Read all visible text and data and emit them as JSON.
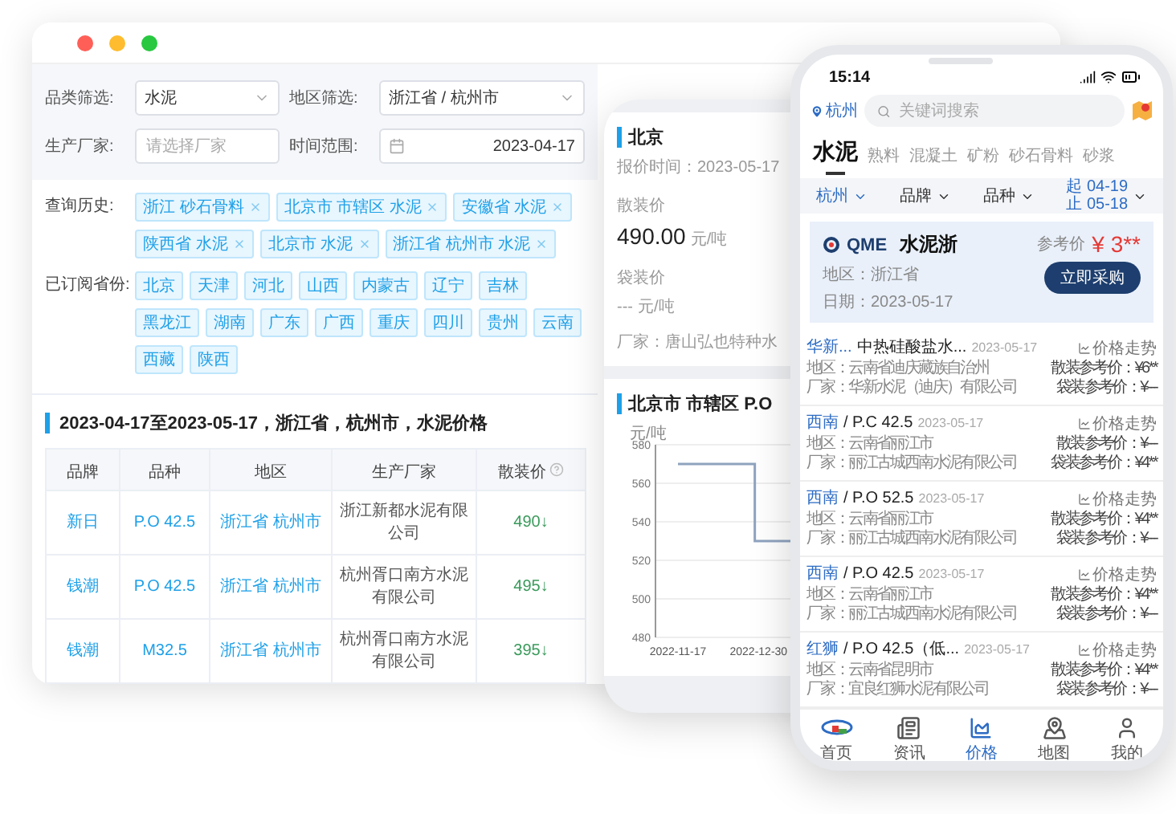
{
  "desktop": {
    "filters": [
      {
        "kind": "select",
        "label": "品类筛选:",
        "value": "水泥"
      },
      {
        "kind": "select",
        "label": "地区筛选:",
        "value": "浙江省 / 杭州市"
      },
      {
        "kind": "input",
        "label": "生产厂家:",
        "placeholder": "请选择厂家"
      },
      {
        "kind": "date",
        "label": "时间范围:",
        "value": "2023-04-17"
      }
    ],
    "history": {
      "label": "查询历史:",
      "tags": [
        "浙江 砂石骨料",
        "北京市 市辖区 水泥",
        "安徽省 水泥",
        "陕西省 水泥",
        "北京市 水泥",
        "浙江省 杭州市 水泥"
      ]
    },
    "provinces": {
      "label": "已订阅省份:",
      "tags": [
        "北京",
        "天津",
        "河北",
        "山西",
        "内蒙古",
        "辽宁",
        "吉林",
        "黑龙江",
        "湖南",
        "广东",
        "广西",
        "重庆",
        "四川",
        "贵州",
        "云南",
        "西藏",
        "陕西"
      ]
    },
    "title": "2023-04-17至2023-05-17，浙江省，杭州市，水泥价格",
    "table": {
      "columns": [
        "品牌",
        "品种",
        "地区",
        "生产厂家",
        "散装价"
      ],
      "rows": [
        [
          "新日",
          "P.O 42.5",
          "浙江省 杭州市",
          "浙江新都水泥有限公司",
          "490↓"
        ],
        [
          "钱潮",
          "P.O 42.5",
          "浙江省 杭州市",
          "杭州胥口南方水泥有限公司",
          "495↓"
        ],
        [
          "钱潮",
          "M32.5",
          "浙江省 杭州市",
          "杭州胥口南方水泥有限公司",
          "395↓"
        ]
      ]
    }
  },
  "tablet": {
    "title": "北京",
    "quote_time": "报价时间：2023-05-17",
    "bulk_label": "散装价",
    "bulk_value": "490.00",
    "bulk_unit": "元/吨",
    "bag_label": "袋装价",
    "bag_value": "---",
    "bag_unit": "元/吨",
    "factory": "厂家：唐山弘也特种水",
    "chart_title": "北京市 市辖区 P.O",
    "chart_data": {
      "type": "line",
      "ylabel": "元/吨",
      "x": [
        "2022-11-17",
        "2022-12-28",
        "2022-12-28",
        "2023-01-16"
      ],
      "series": [
        {
          "color": "#8fa3bf",
          "values": [
            570,
            570,
            530,
            530
          ]
        }
      ],
      "xlim": [
        "2022-11-05",
        "2023-01-16"
      ],
      "ylim": [
        480,
        580
      ],
      "yticks": [
        480,
        500,
        520,
        540,
        560,
        580
      ],
      "xticks": [
        "2022-11-17",
        "2022-12-30"
      ],
      "grid": true
    }
  },
  "phone": {
    "time": "15:14",
    "location": "杭州",
    "search_placeholder": "关键词搜索",
    "tabs": [
      {
        "label": "水泥",
        "selected": true
      },
      {
        "label": "熟料",
        "selected": false
      },
      {
        "label": "混凝土",
        "selected": false
      },
      {
        "label": "矿粉",
        "selected": false
      },
      {
        "label": "砂石骨料",
        "selected": false
      },
      {
        "label": "砂浆",
        "selected": false
      }
    ],
    "filters": [
      {
        "kind": "dropdown",
        "label": "杭州"
      },
      {
        "kind": "dropdown",
        "label": "品牌"
      },
      {
        "kind": "dropdown",
        "label": "品种"
      },
      {
        "kind": "range",
        "lines": [
          "起 04-19",
          "止 05-18"
        ]
      }
    ],
    "promo": {
      "logo": "QME",
      "title": "水泥浙",
      "region": "地区：浙江省",
      "date": "日期：2023-05-17",
      "price_label": "参考价",
      "price": "¥ 3**",
      "button": "立即采购"
    },
    "items": [
      {
        "brand": "华新...",
        "model": "中热硅酸盐水...",
        "date": "2023-05-17",
        "trend": "价格走势",
        "region": "地区：云南省迪庆藏族自治州",
        "bulk": "散装参考价：¥6**",
        "factory": "厂家：华新水泥（迪庆）有限公司",
        "bag": "袋装参考价：¥---"
      },
      {
        "brand": "西南",
        "model": "/ P.C 42.5",
        "date": "2023-05-17",
        "trend": "价格走势",
        "region": "地区：云南省丽江市",
        "bulk": "散装参考价：¥---",
        "factory": "厂家：丽江古城西南水泥有限公司",
        "bag": "袋装参考价：¥4**"
      },
      {
        "brand": "西南",
        "model": "/ P.O 52.5",
        "date": "2023-05-17",
        "trend": "价格走势",
        "region": "地区：云南省丽江市",
        "bulk": "散装参考价：¥4**",
        "factory": "厂家：丽江古城西南水泥有限公司",
        "bag": "袋装参考价：¥---"
      },
      {
        "brand": "西南",
        "model": "/ P.O 42.5",
        "date": "2023-05-17",
        "trend": "价格走势",
        "region": "地区：云南省丽江市",
        "bulk": "散装参考价：¥4**",
        "factory": "厂家：丽江古城西南水泥有限公司",
        "bag": "袋装参考价：¥---"
      },
      {
        "brand": "红狮",
        "model": "/ P.O 42.5（低...",
        "date": "2023-05-17",
        "trend": "价格走势",
        "region": "地区：云南省昆明市",
        "bulk": "散装参考价：¥4**",
        "factory": "厂家：宜良红狮水泥有限公司",
        "bag": "袋装参考价：¥---"
      }
    ],
    "nav": [
      {
        "kind": "home",
        "label": "首页",
        "selected": false
      },
      {
        "kind": "news",
        "label": "资讯",
        "selected": false
      },
      {
        "kind": "price",
        "label": "价格",
        "selected": true
      },
      {
        "kind": "map",
        "label": "地图",
        "selected": false
      },
      {
        "kind": "me",
        "label": "我的",
        "selected": false
      }
    ]
  }
}
